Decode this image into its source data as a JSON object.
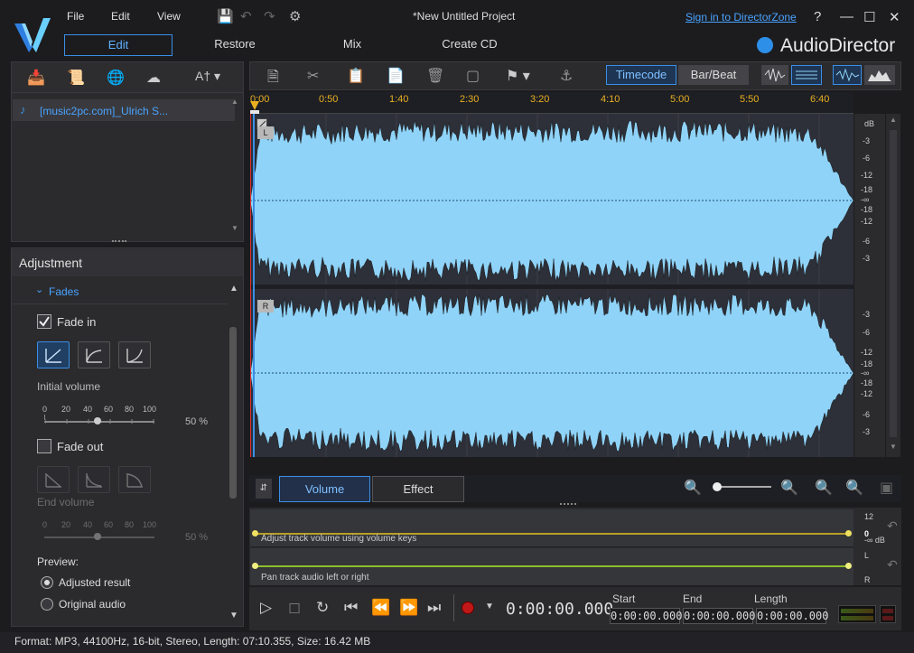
{
  "menu": {
    "file": "File",
    "edit": "Edit",
    "view": "View"
  },
  "window": {
    "title": "*New Untitled Project",
    "sign_in": "Sign in to DirectorZone",
    "help": "?"
  },
  "brand": {
    "name": "AudioDirector",
    "accent": "#2e8fe8"
  },
  "modes": {
    "edit": "Edit",
    "restore": "Restore",
    "mix": "Mix",
    "create_cd": "Create CD"
  },
  "library": {
    "font_button": "A",
    "items": [
      {
        "label": "[music2pc.com]_Ulrich S..."
      }
    ]
  },
  "adjustment": {
    "title": "Adjustment",
    "section": "Fades",
    "fade_in": {
      "label": "Fade in",
      "checked": true,
      "volume_label": "Initial volume",
      "value": "50 %"
    },
    "fade_out": {
      "label": "Fade out",
      "checked": false,
      "volume_label": "End volume",
      "value": "50 %"
    },
    "scale": [
      "0",
      "20",
      "40",
      "60",
      "80",
      "100"
    ],
    "preview": {
      "label": "Preview:",
      "options": [
        {
          "label": "Adjusted result",
          "selected": true
        },
        {
          "label": "Original audio",
          "selected": false
        }
      ]
    }
  },
  "toolbar": {
    "timecode": "Timecode",
    "barbeat": "Bar/Beat"
  },
  "timeline": {
    "marks": [
      "0:00",
      "0:50",
      "1:40",
      "2:30",
      "3:20",
      "4:10",
      "5:00",
      "5:50",
      "6:40"
    ]
  },
  "channels": {
    "left": "L",
    "right": "R"
  },
  "db_scale": {
    "unit": "dB",
    "left": [
      "-3",
      "-6",
      "-12",
      "-18",
      "-∞",
      "-18",
      "-12",
      "-6",
      "-3"
    ],
    "right": [
      "-3",
      "-6",
      "-12",
      "-18",
      "-∞",
      "-18",
      "-12",
      "-6",
      "-3"
    ]
  },
  "waveform_color": "#8fd3f8",
  "tabs": {
    "volume": "Volume",
    "effect": "Effect"
  },
  "envelopes": {
    "volume_hint": "Adjust track volume using volume keys",
    "pan_hint": "Pan track audio left or right",
    "vol_scale": [
      "12",
      "0",
      "-∞ dB"
    ],
    "pan_scale": [
      "L",
      "R"
    ]
  },
  "transport": {
    "time": "0:00:00.000",
    "start_label": "Start",
    "end_label": "End",
    "length_label": "Length",
    "start": "0:00:00.000",
    "end": "0:00:00.000",
    "length": "0:00:00.000"
  },
  "status": "Format: MP3, 44100Hz, 16-bit, Stereo, Length: 07:10.355, Size: 16.42 MB"
}
